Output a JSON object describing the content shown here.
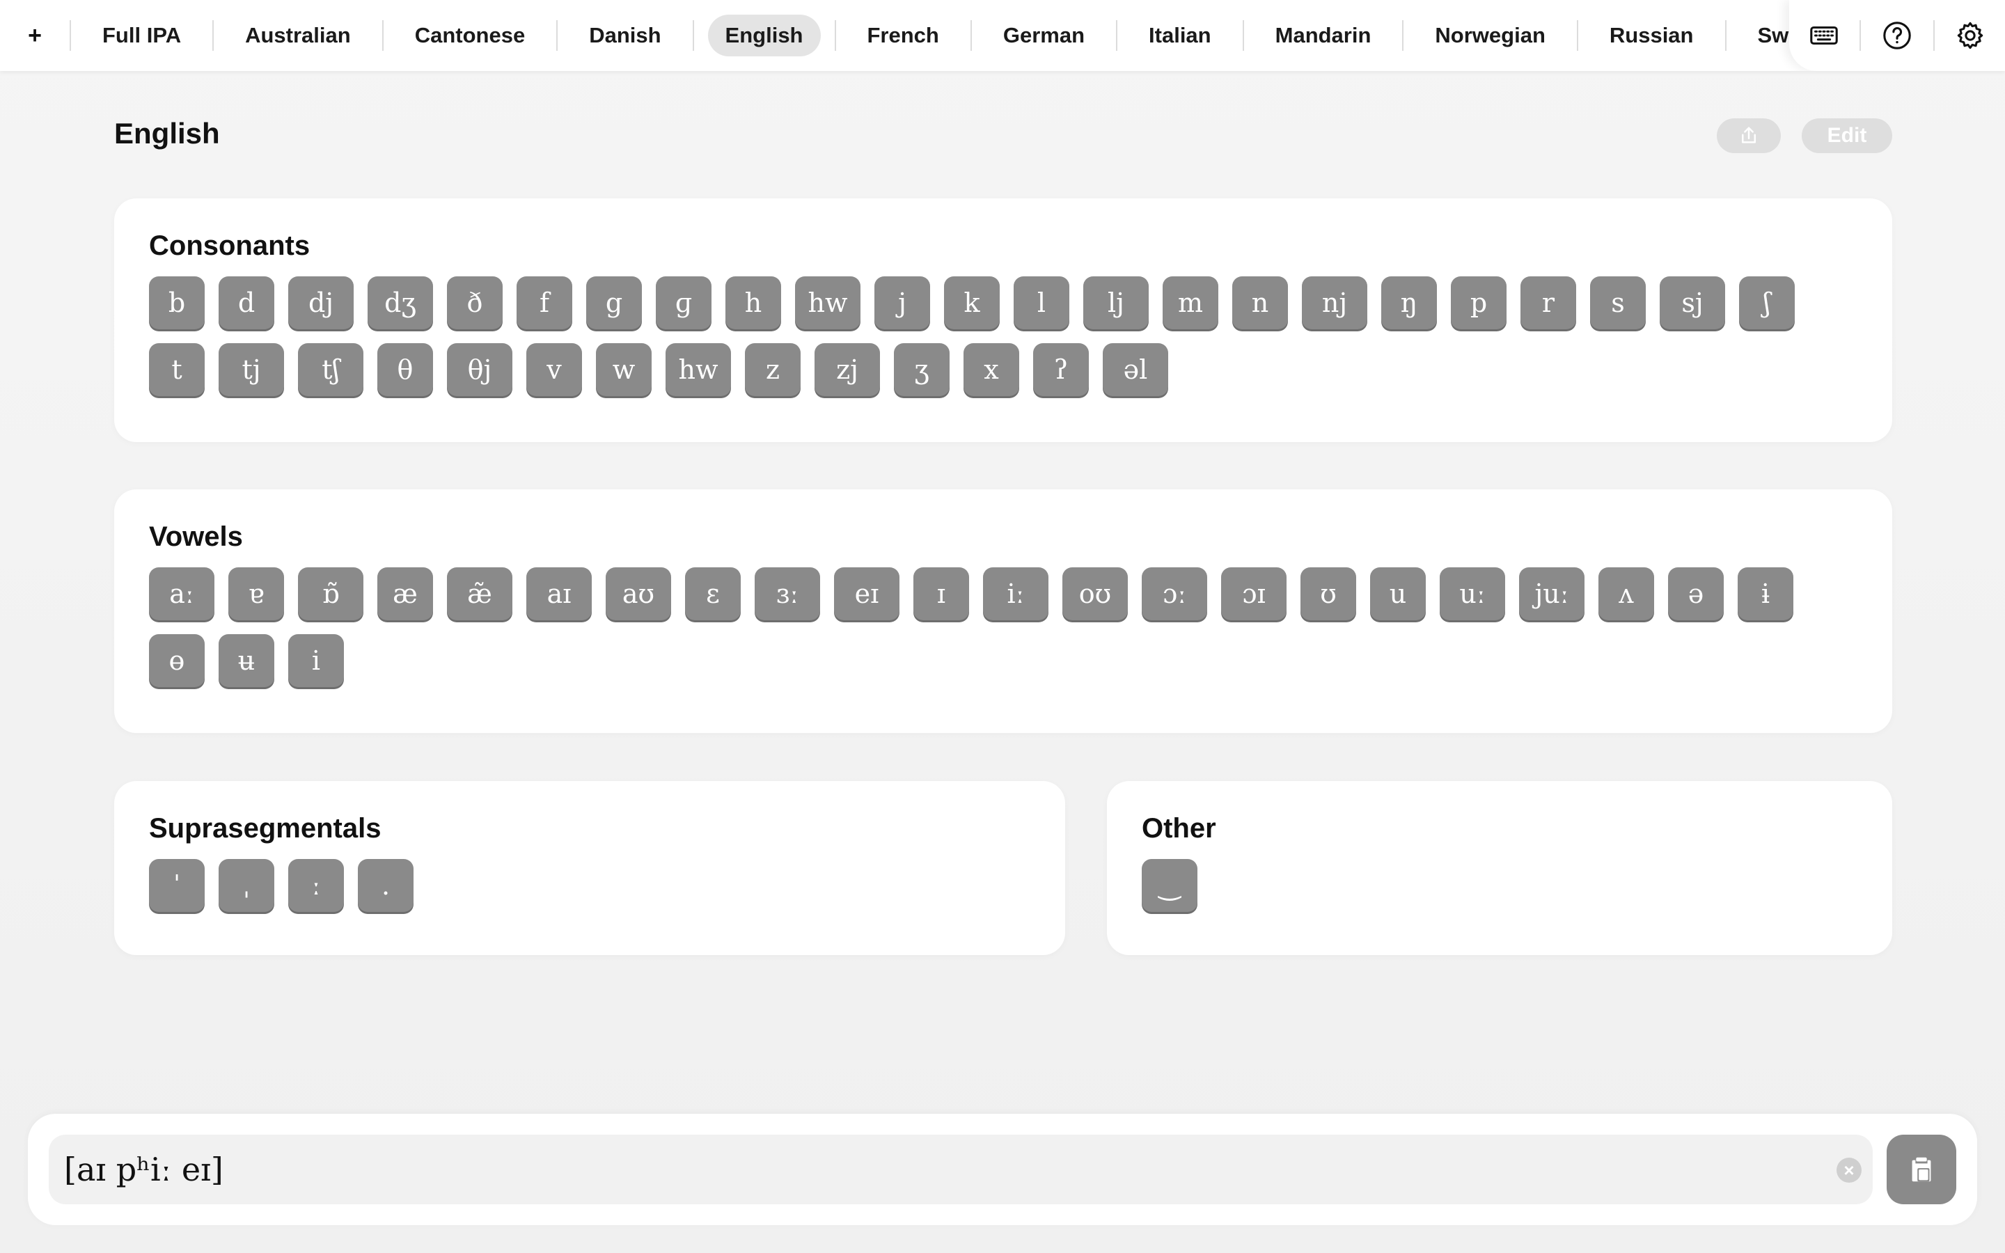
{
  "topbar": {
    "plus_label": "+",
    "tabs": [
      {
        "label": "Full IPA",
        "active": false
      },
      {
        "label": "Australian",
        "active": false
      },
      {
        "label": "Cantonese",
        "active": false
      },
      {
        "label": "Danish",
        "active": false
      },
      {
        "label": "English",
        "active": true
      },
      {
        "label": "French",
        "active": false
      },
      {
        "label": "German",
        "active": false
      },
      {
        "label": "Italian",
        "active": false
      },
      {
        "label": "Mandarin",
        "active": false
      },
      {
        "label": "Norwegian",
        "active": false
      },
      {
        "label": "Russian",
        "active": false
      },
      {
        "label": "Sw",
        "active": false
      }
    ],
    "actions": [
      "keyboard-icon",
      "help-icon",
      "settings-icon"
    ]
  },
  "page": {
    "title": "English",
    "share_icon": "share-icon",
    "edit_label": "Edit"
  },
  "consonants": {
    "title": "Consonants",
    "keys": [
      "b",
      "d",
      "dj",
      "dʒ",
      "ð",
      "f",
      "g",
      "ɡ",
      "h",
      "hw",
      "j",
      "k",
      "l",
      "lj",
      "m",
      "n",
      "nj",
      "ŋ",
      "p",
      "r",
      "s",
      "sj",
      "ʃ",
      "t",
      "tj",
      "tʃ",
      "θ",
      "θj",
      "v",
      "w",
      "hw",
      "z",
      "zj",
      "ʒ",
      "x",
      "ʔ",
      "əl"
    ]
  },
  "vowels": {
    "title": "Vowels",
    "keys": [
      "aː",
      "ɐ",
      "ɒ̃",
      "æ",
      "æ̃",
      "aɪ",
      "aʊ",
      "ɛ",
      "ɜː",
      "eɪ",
      "ɪ",
      "iː",
      "oʊ",
      "ɔː",
      "ɔɪ",
      "ʊ",
      "u",
      "uː",
      "juː",
      "ʌ",
      "ə",
      "ɨ",
      "ɵ",
      "ʉ",
      "i"
    ]
  },
  "suprasegmentals": {
    "title": "Suprasegmentals",
    "keys": [
      "ˈ",
      "ˌ",
      "ː",
      "."
    ]
  },
  "other": {
    "title": "Other",
    "keys": [
      "‿"
    ]
  },
  "input": {
    "value": "[aɪ pʰiː eɪ]",
    "clear_icon": "clear-icon",
    "copy_icon": "copy-icon"
  },
  "colors": {
    "key_bg": "#8a8a8a",
    "active_tab_bg": "#e4e4e4",
    "card_bg": "#ffffff"
  }
}
